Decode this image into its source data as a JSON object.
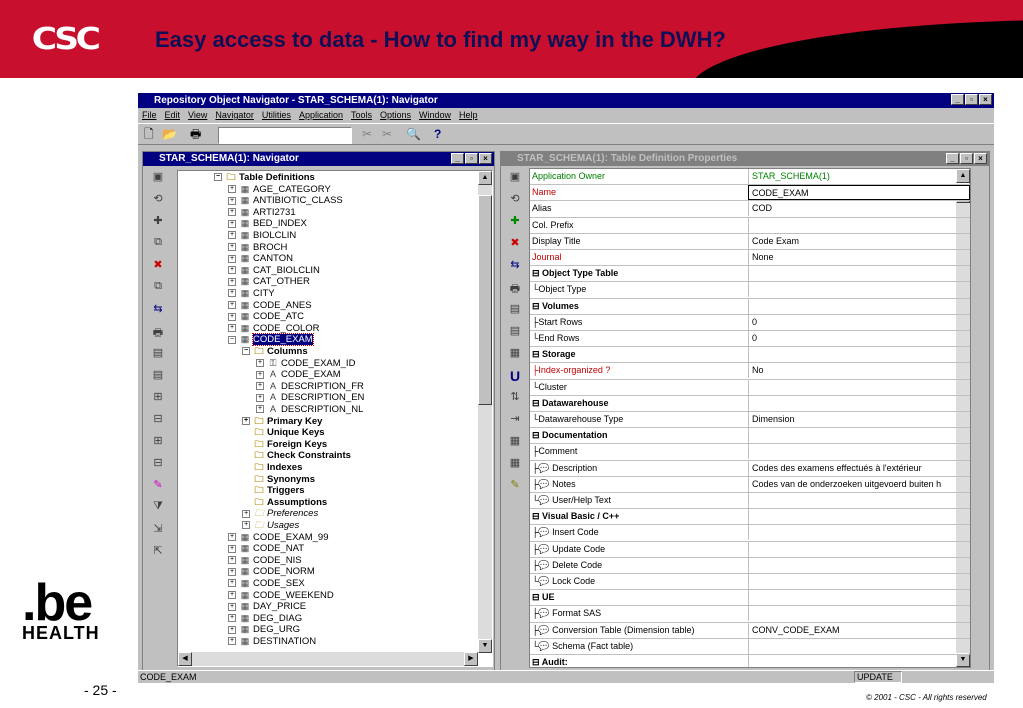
{
  "slide": {
    "logo": "CSC",
    "title": "Easy access to data - How to find my way in the DWH?",
    "page_number": "- 25 -",
    "copyright": "© 2001 - CSC  -  All rights reserved",
    "brand_be": ".be",
    "brand_health": "HEALTH"
  },
  "app": {
    "title": "Repository Object Navigator - STAR_SCHEMA(1): Navigator",
    "menu": [
      "File",
      "Edit",
      "View",
      "Navigator",
      "Utilities",
      "Application",
      "Tools",
      "Options",
      "Window",
      "Help"
    ],
    "status_left": "CODE_EXAM",
    "status_right": "UPDATE"
  },
  "navigator": {
    "title": "STAR_SCHEMA(1): Navigator",
    "tree": [
      {
        "label": "Table Definitions",
        "level": 2,
        "pm": "−",
        "icon": "folder",
        "bold": true
      },
      {
        "label": "AGE_CATEGORY",
        "level": 3,
        "pm": "+",
        "icon": "table"
      },
      {
        "label": "ANTIBIOTIC_CLASS",
        "level": 3,
        "pm": "+",
        "icon": "table"
      },
      {
        "label": "ARTI2731",
        "level": 3,
        "pm": "+",
        "icon": "table"
      },
      {
        "label": "BED_INDEX",
        "level": 3,
        "pm": "+",
        "icon": "table"
      },
      {
        "label": "BIOLCLIN",
        "level": 3,
        "pm": "+",
        "icon": "table"
      },
      {
        "label": "BROCH",
        "level": 3,
        "pm": "+",
        "icon": "table"
      },
      {
        "label": "CANTON",
        "level": 3,
        "pm": "+",
        "icon": "table"
      },
      {
        "label": "CAT_BIOLCLIN",
        "level": 3,
        "pm": "+",
        "icon": "table"
      },
      {
        "label": "CAT_OTHER",
        "level": 3,
        "pm": "+",
        "icon": "table"
      },
      {
        "label": "CITY",
        "level": 3,
        "pm": "+",
        "icon": "table"
      },
      {
        "label": "CODE_ANES",
        "level": 3,
        "pm": "+",
        "icon": "table"
      },
      {
        "label": "CODE_ATC",
        "level": 3,
        "pm": "+",
        "icon": "table"
      },
      {
        "label": "CODE_COLOR",
        "level": 3,
        "pm": "+",
        "icon": "table"
      },
      {
        "label": "CODE_EXAM",
        "level": 3,
        "pm": "−",
        "icon": "table",
        "selected": true
      },
      {
        "label": "Columns",
        "level": 4,
        "pm": "−",
        "icon": "folder",
        "bold": true
      },
      {
        "label": "CODE_EXAM_ID",
        "level": 5,
        "pm": "+",
        "icon": "key"
      },
      {
        "label": "CODE_EXAM",
        "level": 5,
        "pm": "+",
        "icon": "A"
      },
      {
        "label": "DESCRIPTION_FR",
        "level": 5,
        "pm": "+",
        "icon": "A"
      },
      {
        "label": "DESCRIPTION_EN",
        "level": 5,
        "pm": "+",
        "icon": "A"
      },
      {
        "label": "DESCRIPTION_NL",
        "level": 5,
        "pm": "+",
        "icon": "A"
      },
      {
        "label": "Primary Key",
        "level": 4,
        "pm": "+",
        "icon": "folder",
        "bold": true
      },
      {
        "label": "Unique Keys",
        "level": 4,
        "pm": "",
        "icon": "folder",
        "bold": true
      },
      {
        "label": "Foreign Keys",
        "level": 4,
        "pm": "",
        "icon": "folder",
        "bold": true
      },
      {
        "label": "Check Constraints",
        "level": 4,
        "pm": "",
        "icon": "folder",
        "bold": true
      },
      {
        "label": "Indexes",
        "level": 4,
        "pm": "",
        "icon": "folder",
        "bold": true
      },
      {
        "label": "Synonyms",
        "level": 4,
        "pm": "",
        "icon": "folder",
        "bold": true
      },
      {
        "label": "Triggers",
        "level": 4,
        "pm": "",
        "icon": "folder",
        "bold": true
      },
      {
        "label": "Assumptions",
        "level": 4,
        "pm": "",
        "icon": "folder",
        "bold": true
      },
      {
        "label": "Preferences",
        "level": 4,
        "pm": "+",
        "icon": "folder",
        "italic": true
      },
      {
        "label": "Usages",
        "level": 4,
        "pm": "+",
        "icon": "folder",
        "italic": true
      },
      {
        "label": "CODE_EXAM_99",
        "level": 3,
        "pm": "+",
        "icon": "table"
      },
      {
        "label": "CODE_NAT",
        "level": 3,
        "pm": "+",
        "icon": "table"
      },
      {
        "label": "CODE_NIS",
        "level": 3,
        "pm": "+",
        "icon": "table"
      },
      {
        "label": "CODE_NORM",
        "level": 3,
        "pm": "+",
        "icon": "table"
      },
      {
        "label": "CODE_SEX",
        "level": 3,
        "pm": "+",
        "icon": "table"
      },
      {
        "label": "CODE_WEEKEND",
        "level": 3,
        "pm": "+",
        "icon": "table"
      },
      {
        "label": "DAY_PRICE",
        "level": 3,
        "pm": "+",
        "icon": "table"
      },
      {
        "label": "DEG_DIAG",
        "level": 3,
        "pm": "+",
        "icon": "table"
      },
      {
        "label": "DEG_URG",
        "level": 3,
        "pm": "+",
        "icon": "table"
      },
      {
        "label": "DESTINATION",
        "level": 3,
        "pm": "+",
        "icon": "table"
      }
    ]
  },
  "properties": {
    "title": "STAR_SCHEMA(1): Table Definition Properties",
    "rows": [
      {
        "k": "Application Owner",
        "v": "STAR_SCHEMA(1)",
        "kc": "grn",
        "vc": "grn"
      },
      {
        "k": "Name",
        "v": "CODE_EXAM",
        "kc": "red",
        "vc": "box"
      },
      {
        "k": "Alias",
        "v": "COD"
      },
      {
        "k": "Col. Prefix",
        "v": ""
      },
      {
        "k": "Display Title",
        "v": "Code Exam"
      },
      {
        "k": "Journal",
        "v": "None",
        "kc": "red"
      },
      {
        "k": "⊟ Object Type Table",
        "v": "",
        "sec": true
      },
      {
        "k": "  └Object Type",
        "v": ""
      },
      {
        "k": "⊟ Volumes",
        "v": "",
        "sec": true
      },
      {
        "k": "  ├Start Rows",
        "v": "0"
      },
      {
        "k": "  └End Rows",
        "v": "0"
      },
      {
        "k": "⊟ Storage",
        "v": "",
        "sec": true
      },
      {
        "k": "  ├Index-organized ?",
        "v": "No",
        "kc": "red"
      },
      {
        "k": "  └Cluster",
        "v": ""
      },
      {
        "k": "⊟ Datawarehouse",
        "v": "",
        "sec": true
      },
      {
        "k": "  └Datawarehouse Type",
        "v": "Dimension"
      },
      {
        "k": "⊟ Documentation",
        "v": "",
        "sec": true
      },
      {
        "k": "  ├Comment",
        "v": ""
      },
      {
        "k": "  ├💬 Description",
        "v": "Codes des examens effectués à l'extérieur"
      },
      {
        "k": "  ├💬 Notes",
        "v": "Codes van de onderzoeken uitgevoerd buiten h"
      },
      {
        "k": "  └💬 User/Help Text",
        "v": ""
      },
      {
        "k": "⊟ Visual Basic / C++",
        "v": "",
        "sec": true
      },
      {
        "k": "  ├💬 Insert Code",
        "v": ""
      },
      {
        "k": "  ├💬 Update Code",
        "v": ""
      },
      {
        "k": "  ├💬 Delete Code",
        "v": ""
      },
      {
        "k": "  └💬 Lock Code",
        "v": ""
      },
      {
        "k": "⊟ UE",
        "v": "",
        "sec": true
      },
      {
        "k": "  ├💬 Format SAS",
        "v": ""
      },
      {
        "k": "  ├💬 Conversion Table (Dimension table)",
        "v": "CONV_CODE_EXAM"
      },
      {
        "k": "  └💬 Schema (Fact table)",
        "v": ""
      },
      {
        "k": "⊟ Audit:",
        "v": "",
        "sec": true
      }
    ]
  },
  "colors": {
    "brand_red": "#c8102e",
    "titlebar_blue": "#000080"
  }
}
